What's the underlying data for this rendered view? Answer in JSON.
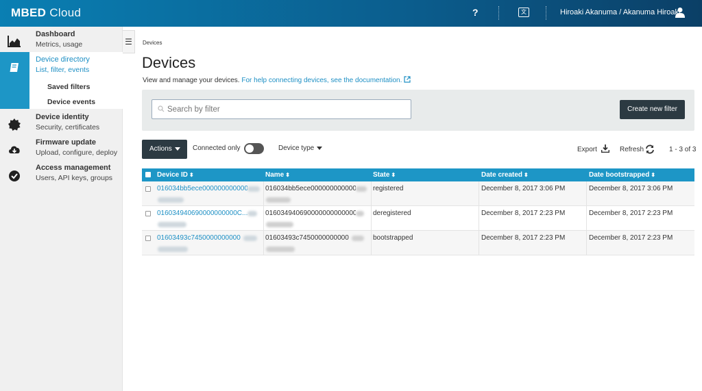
{
  "header": {
    "logo_bold": "MBED",
    "logo_light": " Cloud",
    "help_label": "?",
    "user_name": "Hiroaki Akanuma / Akanuma Hiroaki"
  },
  "sidebar": {
    "items": [
      {
        "title": "Dashboard",
        "subtitle": "Metrics, usage",
        "icon": "chart-icon"
      },
      {
        "title": "Device directory",
        "subtitle": "List, filter, events",
        "icon": "book-icon",
        "active": true,
        "children": [
          "Saved filters",
          "Device events"
        ]
      },
      {
        "title": "Device identity",
        "subtitle": "Security, certificates",
        "icon": "badge-icon"
      },
      {
        "title": "Firmware update",
        "subtitle": "Upload, configure, deploy",
        "icon": "cloud-download-icon"
      },
      {
        "title": "Access management",
        "subtitle": "Users, API keys, groups",
        "icon": "check-circle-icon"
      }
    ]
  },
  "main": {
    "breadcrumb": "Devices",
    "title": "Devices",
    "intro_text": "View and manage your devices. ",
    "intro_link": "For help connecting devices, see the documentation.",
    "search_placeholder": "Search by filter",
    "create_filter_label": "Create new filter",
    "actions_label": "Actions",
    "connected_only_label": "Connected only",
    "connected_only": false,
    "device_type_label": "Device type",
    "export_label": "Export",
    "refresh_label": "Refresh",
    "count_label": "1 - 3 of 3"
  },
  "table": {
    "columns": [
      "Device ID",
      "Name",
      "State",
      "Date created",
      "Date bootstrapped"
    ],
    "rows": [
      {
        "device_id": "016034bb5ece000000000000",
        "name": "016034bb5ece000000000000",
        "state": "registered",
        "created": "December 8, 2017 3:06 PM",
        "bootstrapped": "December 8, 2017 3:06 PM"
      },
      {
        "device_id": "016034940690000000000C...",
        "name": "016034940690000000000000",
        "state": "deregistered",
        "created": "December 8, 2017 2:23 PM",
        "bootstrapped": "December 8, 2017 2:23 PM"
      },
      {
        "device_id": "01603493c7450000000000",
        "name": "01603493c7450000000000",
        "state": "bootstrapped",
        "created": "December 8, 2017 2:23 PM",
        "bootstrapped": "December 8, 2017 2:23 PM"
      }
    ]
  },
  "colors": {
    "header_start": "#0a7fb3",
    "header_end": "#0b3f66",
    "accent": "#1d96c6",
    "dark_button": "#2c3a42"
  }
}
